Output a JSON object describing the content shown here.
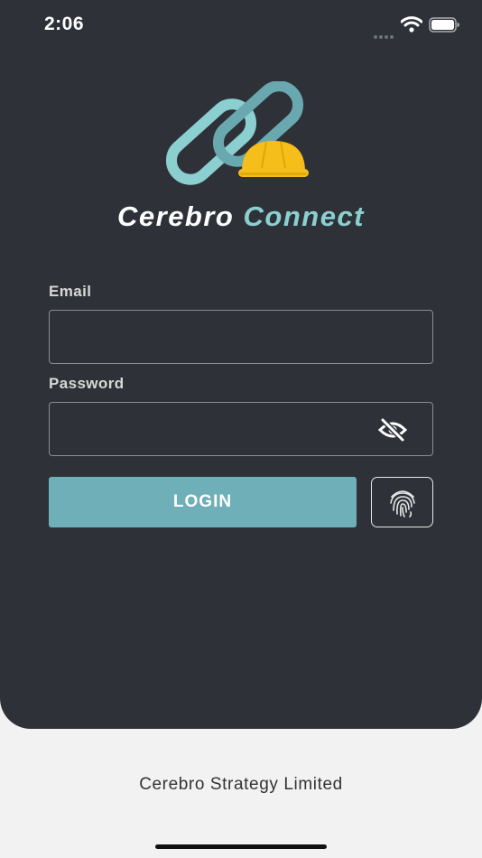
{
  "status_bar": {
    "time": "2:06"
  },
  "brand": {
    "word1": "Cerebro",
    "word2": "Connect"
  },
  "form": {
    "email_label": "Email",
    "email_value": "",
    "password_label": "Password",
    "password_value": "",
    "login_label": "LOGIN"
  },
  "footer": {
    "company": "Cerebro Strategy Limited"
  },
  "colors": {
    "panel": "#2e3238",
    "accent": "#6fafb7",
    "brand_accent": "#8ccfd0",
    "helmet": "#f5be1b",
    "background": "#f2f2f2"
  },
  "icons": [
    "wifi-icon",
    "battery-icon",
    "chain-link-icon",
    "hard-hat-icon",
    "eye-slash-icon",
    "fingerprint-icon"
  ]
}
